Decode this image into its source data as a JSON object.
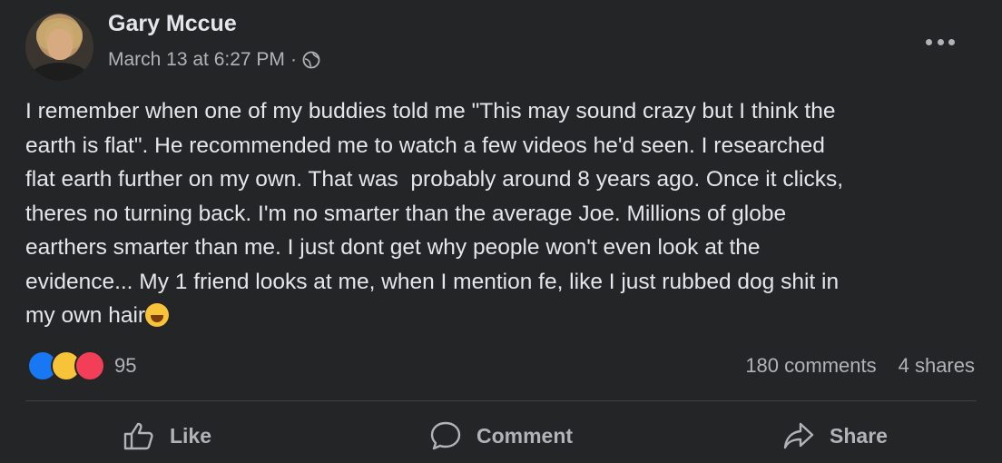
{
  "post": {
    "author": "Gary Mccue",
    "timestamp": "March 13 at 6:27 PM",
    "separator": "·",
    "privacy_icon": "globe-icon",
    "text": "I remember when one of my buddies told me \"This may sound crazy but I think the\nearth is flat\". He recommended me to watch a few videos he'd seen. I researched\nflat earth further on my own. That was  probably around 8 years ago. Once it clicks,\ntheres no turning back. I'm no smarter than the average Joe. Millions of globe\nearthers smarter than me. I just dont get why people won't even look at the\nevidence... My 1 friend looks at me, when I mention fe, like I just rubbed dog shit in\nmy own hair",
    "emoji": "grinning-tongue-emoji"
  },
  "engagement": {
    "reactions": [
      "like-icon",
      "haha-icon",
      "love-icon"
    ],
    "reaction_count": "95",
    "comments": "180 comments",
    "shares": "4 shares"
  },
  "actions": {
    "like": "Like",
    "comment": "Comment",
    "share": "Share"
  },
  "colors": {
    "background": "#242526",
    "text": "#e4e6eb",
    "secondary": "#b0b3b8",
    "like": "#1877f2",
    "love": "#f33e58",
    "haha": "#f7c338"
  }
}
